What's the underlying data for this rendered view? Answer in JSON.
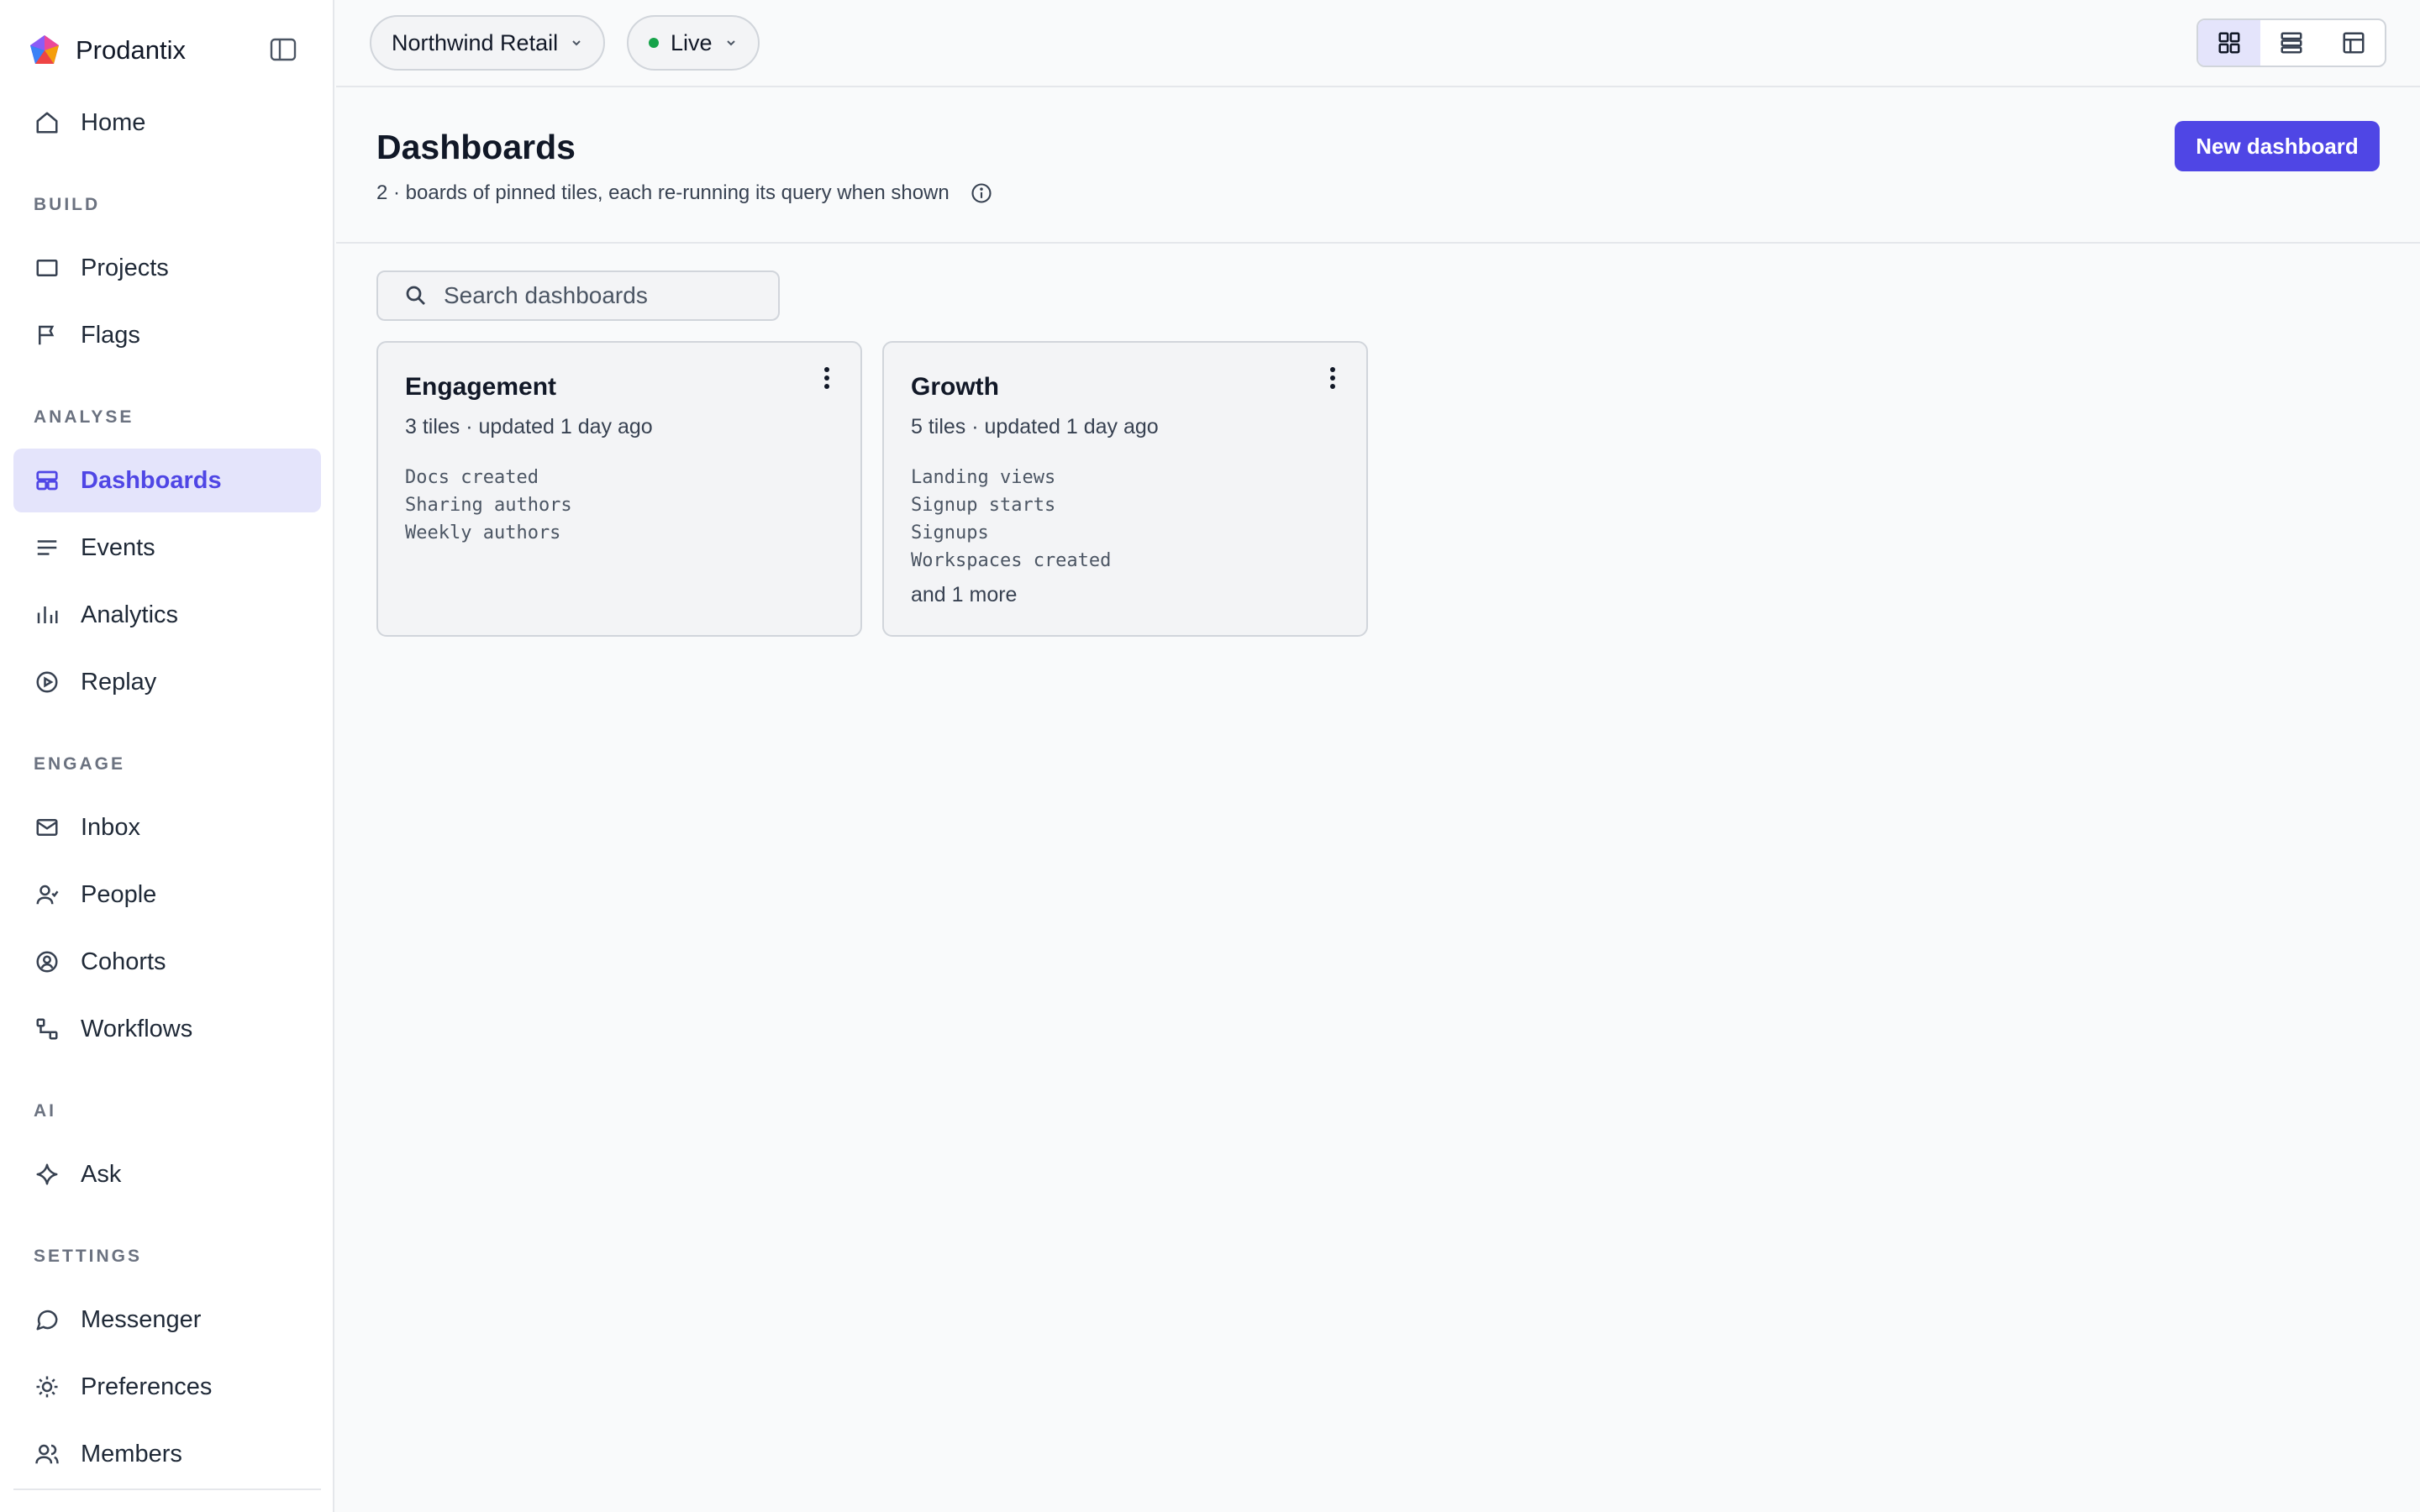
{
  "brand": {
    "name": "Prodantix"
  },
  "sidebar": {
    "home": "Home",
    "sections": {
      "build": "BUILD",
      "analyse": "ANALYSE",
      "engage": "ENGAGE",
      "ai": "AI",
      "settings": "SETTINGS"
    },
    "items": {
      "projects": "Projects",
      "flags": "Flags",
      "dashboards": "Dashboards",
      "events": "Events",
      "analytics": "Analytics",
      "replay": "Replay",
      "inbox": "Inbox",
      "people": "People",
      "cohorts": "Cohorts",
      "workflows": "Workflows",
      "ask": "Ask",
      "messenger": "Messenger",
      "preferences": "Preferences",
      "members": "Members"
    },
    "active": "Dashboards"
  },
  "topbar": {
    "workspace": "Northwind Retail",
    "environment": "Live",
    "environment_status_color": "#16a34a",
    "view_modes": [
      "grid-icon",
      "list-icon",
      "layout-icon"
    ],
    "active_view": "grid"
  },
  "page": {
    "title": "Dashboards",
    "subtitle": "2 · boards of pinned tiles, each re-running its query when shown",
    "new_button": "New dashboard",
    "accent_color": "#4f46e5"
  },
  "search": {
    "placeholder": "Search dashboards",
    "value": ""
  },
  "dashboards": [
    {
      "title": "Engagement",
      "meta": "3 tiles · updated 1 day ago",
      "tiles": [
        "Docs created",
        "Sharing authors",
        "Weekly authors"
      ],
      "more": ""
    },
    {
      "title": "Growth",
      "meta": "5 tiles · updated 1 day ago",
      "tiles": [
        "Landing views",
        "Signup starts",
        "Signups",
        "Workspaces created"
      ],
      "more": "and 1 more"
    }
  ]
}
